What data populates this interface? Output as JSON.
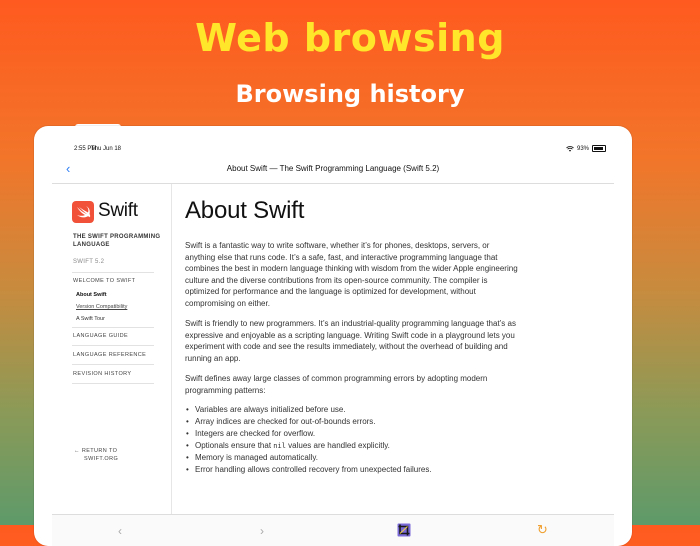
{
  "headline": {
    "title": "Web browsing",
    "subtitle": "Browsing history"
  },
  "status_bar": {
    "time": "2:55 PM",
    "date": "Thu Jun 18",
    "battery": "93%"
  },
  "navbar": {
    "back_icon": "chevron-left-icon",
    "title": "About Swift — The Swift Programming Language (Swift 5.2)"
  },
  "sidebar": {
    "logo_text": "Swift",
    "book_title": "THE SWIFT PROGRAMMING LANGUAGE",
    "book_version": "SWIFT 5.2",
    "welcome": "WELCOME TO SWIFT",
    "welcome_items": [
      "About Swift",
      "Version Compatibility",
      "A Swift Tour"
    ],
    "language_guide": "LANGUAGE GUIDE",
    "language_reference": "LANGUAGE REFERENCE",
    "revision_history": "REVISION HISTORY",
    "return_line1": "← RETURN TO",
    "return_line2": "SWIFT.ORG"
  },
  "content": {
    "title": "About Swift",
    "p1": "Swift is a fantastic way to write software, whether it’s for phones, desktops, servers, or anything else that runs code. It’s a safe, fast, and interactive programming language that combines the best in modern language thinking with wisdom from the wider Apple engineering culture and the diverse contributions from its open-source community. The compiler is optimized for performance and the language is optimized for development, without compromising on either.",
    "p2": "Swift is friendly to new programmers. It’s an industrial-quality programming language that’s as expressive and enjoyable as a scripting language. Writing Swift code in a playground lets you experiment with code and see the results immediately, without the overhead of building and running an app.",
    "p3": "Swift defines away large classes of common programming errors by adopting modern programming patterns:",
    "bullets": [
      "Variables are always initialized before use.",
      "Array indices are checked for out-of-bounds errors.",
      "Integers are checked for overflow.",
      "Memory is managed automatically.",
      "Error handling allows controlled recovery from unexpected failures."
    ],
    "bullet_optionals_pre": "Optionals ensure that ",
    "bullet_optionals_code": "nil",
    "bullet_optionals_post": " values are handled explicitly."
  },
  "toolbar": {
    "back_icon": "chevron-left-icon",
    "forward_icon": "chevron-right-icon",
    "crop_icon": "crop-icon",
    "reload_icon": "reload-icon"
  },
  "colors": {
    "accent": "#2a7cf4",
    "swift_orange": "#f05138",
    "headline_yellow": "#ffe62a"
  }
}
